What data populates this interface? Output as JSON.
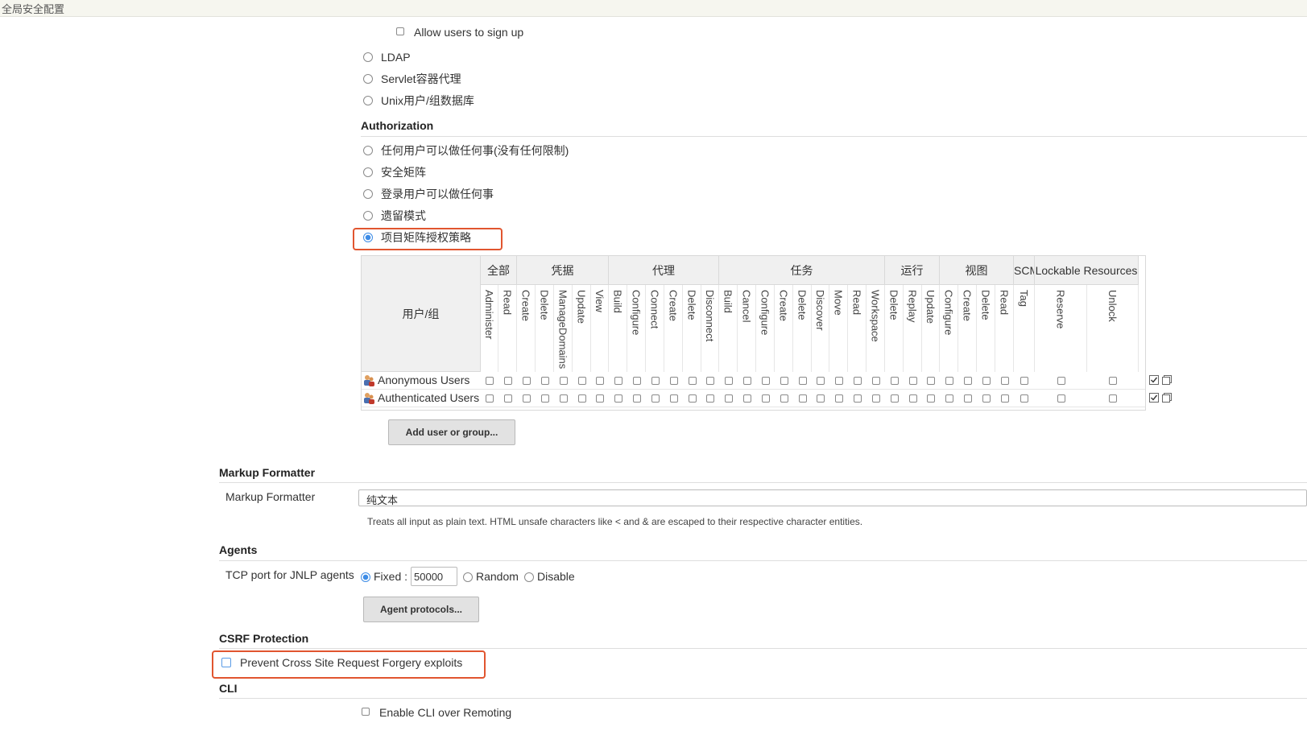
{
  "page": {
    "title": "全局安全配置"
  },
  "security_realm": {
    "allow_signup": {
      "label": "Allow users to sign up",
      "checked": false
    },
    "options": [
      {
        "label": "LDAP",
        "selected": false
      },
      {
        "label": "Servlet容器代理",
        "selected": false
      },
      {
        "label": "Unix用户/组数据库",
        "selected": false
      }
    ]
  },
  "authorization": {
    "title": "Authorization",
    "options": [
      {
        "label": "任何用户可以做任何事(没有任何限制)",
        "selected": false
      },
      {
        "label": "安全矩阵",
        "selected": false
      },
      {
        "label": "登录用户可以做任何事",
        "selected": false
      },
      {
        "label": "遗留模式",
        "selected": false
      },
      {
        "label": "项目矩阵授权策略",
        "selected": true
      }
    ],
    "matrix": {
      "user_column_header": "用户/组",
      "groups": [
        {
          "label": "全部",
          "permissions": [
            "Administer",
            "Read"
          ]
        },
        {
          "label": "凭据",
          "permissions": [
            "Create",
            "Delete",
            "ManageDomains",
            "Update",
            "View"
          ]
        },
        {
          "label": "代理",
          "permissions": [
            "Build",
            "Configure",
            "Connect",
            "Create",
            "Delete",
            "Disconnect"
          ]
        },
        {
          "label": "任务",
          "permissions": [
            "Build",
            "Cancel",
            "Configure",
            "Create",
            "Delete",
            "Discover",
            "Move",
            "Read",
            "Workspace"
          ]
        },
        {
          "label": "运行",
          "permissions": [
            "Delete",
            "Replay",
            "Update"
          ]
        },
        {
          "label": "视图",
          "permissions": [
            "Configure",
            "Create",
            "Delete",
            "Read"
          ]
        },
        {
          "label": "SCM",
          "permissions": [
            "Tag"
          ]
        },
        {
          "label": "Lockable Resources",
          "permissions": [
            "Reserve",
            "Unlock"
          ]
        }
      ],
      "rows": [
        {
          "name": "Anonymous Users"
        },
        {
          "name": "Authenticated Users"
        }
      ],
      "add_button": "Add user or group..."
    }
  },
  "markup_formatter": {
    "title": "Markup Formatter",
    "field_label": "Markup Formatter",
    "selected": "纯文本",
    "description": "Treats all input as plain text. HTML unsafe characters like < and & are escaped to their respective character entities."
  },
  "agents": {
    "title": "Agents",
    "field_label": "TCP port for JNLP agents",
    "fixed_label": "Fixed :",
    "port_value": "50000",
    "random_label": "Random",
    "disable_label": "Disable",
    "protocols_button": "Agent protocols..."
  },
  "csrf": {
    "title": "CSRF Protection",
    "checkbox_label": "Prevent Cross Site Request Forgery exploits",
    "checked": false
  },
  "cli": {
    "title": "CLI",
    "checkbox_label": "Enable CLI over Remoting",
    "checked": false
  },
  "colors": {
    "accent": "#3d8ce6",
    "highlight": "#e1552f"
  }
}
